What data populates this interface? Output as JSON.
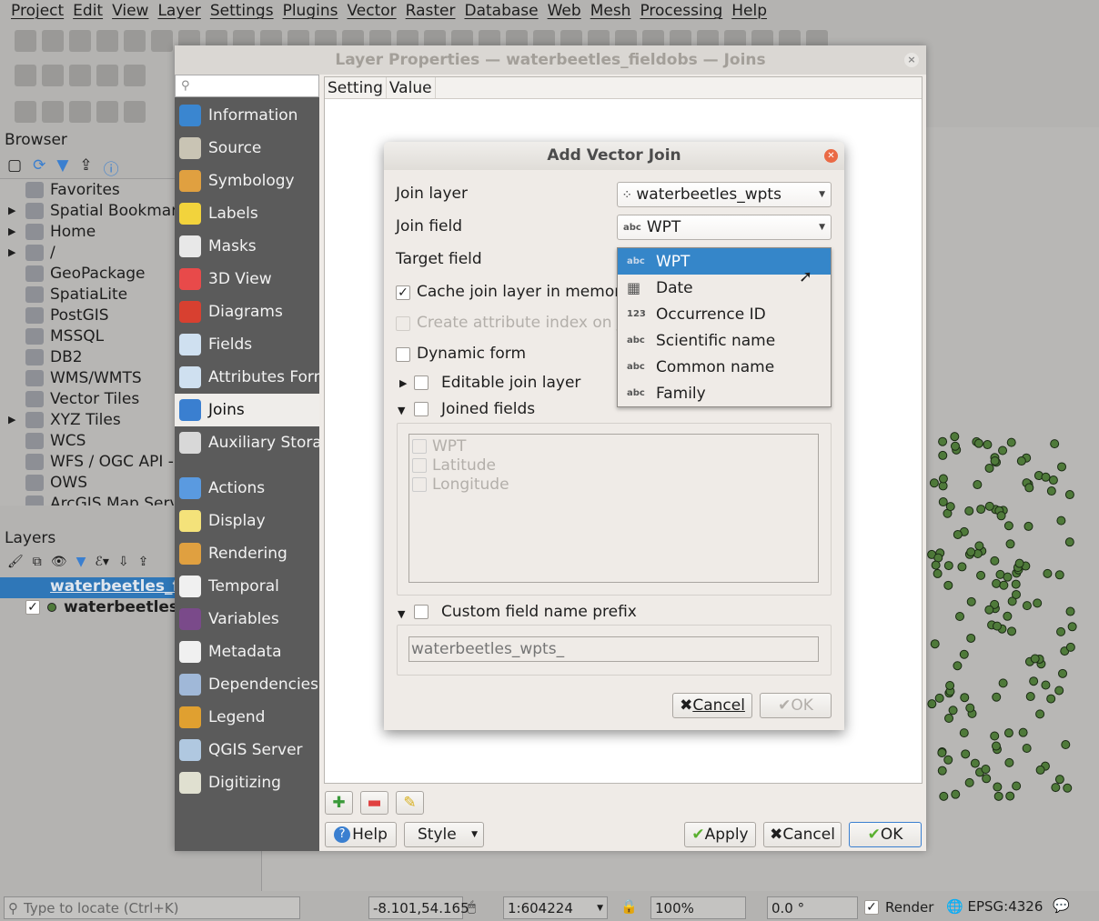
{
  "menubar": [
    "Project",
    "Edit",
    "View",
    "Layer",
    "Settings",
    "Plugins",
    "Vector",
    "Raster",
    "Database",
    "Web",
    "Mesh",
    "Processing",
    "Help"
  ],
  "browser": {
    "title": "Browser",
    "items": [
      {
        "label": "Favorites",
        "icon": "star-icon",
        "expand": false
      },
      {
        "label": "Spatial Bookmarks",
        "icon": "bookmark-icon",
        "expand": true
      },
      {
        "label": "Home",
        "icon": "home-folder-icon",
        "expand": true
      },
      {
        "label": "/",
        "icon": "folder-icon",
        "expand": true
      },
      {
        "label": "GeoPackage",
        "icon": "geopackage-icon",
        "expand": false
      },
      {
        "label": "SpatiaLite",
        "icon": "spatialite-icon",
        "expand": false
      },
      {
        "label": "PostGIS",
        "icon": "postgis-icon",
        "expand": false
      },
      {
        "label": "MSSQL",
        "icon": "mssql-icon",
        "expand": false
      },
      {
        "label": "DB2",
        "icon": "db2-icon",
        "expand": false
      },
      {
        "label": "WMS/WMTS",
        "icon": "globe-icon",
        "expand": false
      },
      {
        "label": "Vector Tiles",
        "icon": "grid-icon",
        "expand": false
      },
      {
        "label": "XYZ Tiles",
        "icon": "tiles-icon",
        "expand": true
      },
      {
        "label": "WCS",
        "icon": "globe-icon",
        "expand": false
      },
      {
        "label": "WFS / OGC API - Features",
        "icon": "globe-icon",
        "expand": false
      },
      {
        "label": "OWS",
        "icon": "globe-icon",
        "expand": false
      },
      {
        "label": "ArcGIS Map Service",
        "icon": "globe-icon",
        "expand": false
      }
    ]
  },
  "layers": {
    "title": "Layers",
    "items": [
      {
        "label": "waterbeetles_fieldobs",
        "selected": true
      },
      {
        "label": "waterbeetles_wpts",
        "checked": true
      }
    ]
  },
  "status": {
    "locate_placeholder": "Type to locate (Ctrl+K)",
    "coordinate": "-8.101,54.165",
    "scale": "1:604224",
    "magnifier": "100%",
    "rotation": "0.0 °",
    "render_label": "Render",
    "render_checked": true,
    "crs": "EPSG:4326"
  },
  "layer_properties": {
    "title": "Layer Properties — waterbeetles_fieldobs — Joins",
    "search_placeholder": "",
    "sections": [
      {
        "label": "Information",
        "color": "#3a86d0"
      },
      {
        "label": "Source",
        "color": "#c9c4b4"
      },
      {
        "label": "Symbology",
        "color": "#e0a040"
      },
      {
        "label": "Labels",
        "color": "#f2d33c"
      },
      {
        "label": "Masks",
        "color": "#e8e8e8"
      },
      {
        "label": "3D View",
        "color": "#e84a4a"
      },
      {
        "label": "Diagrams",
        "color": "#d84030"
      },
      {
        "label": "Fields",
        "color": "#cfe0f0"
      },
      {
        "label": "Attributes Form",
        "color": "#cfe0f0"
      },
      {
        "label": "Joins",
        "color": "#3a7fd0",
        "selected": true
      },
      {
        "label": "Auxiliary Storage",
        "color": "#d8d8d8"
      },
      {
        "label": "Actions",
        "color": "#5a9ae0"
      },
      {
        "label": "Display",
        "color": "#f4e27a"
      },
      {
        "label": "Rendering",
        "color": "#e0a040"
      },
      {
        "label": "Temporal",
        "color": "#f0f0f0"
      },
      {
        "label": "Variables",
        "color": "#7a4a8a"
      },
      {
        "label": "Metadata",
        "color": "#f0f0f0"
      },
      {
        "label": "Dependencies",
        "color": "#a0b8d8"
      },
      {
        "label": "Legend",
        "color": "#e0a030"
      },
      {
        "label": "QGIS Server",
        "color": "#b0c8e0"
      },
      {
        "label": "Digitizing",
        "color": "#e0e0d0"
      }
    ],
    "table_headers": [
      "Setting",
      "Value"
    ],
    "buttons": {
      "help": "Help",
      "style": "Style",
      "apply": "Apply",
      "cancel": "Cancel",
      "ok": "OK"
    }
  },
  "add_vector_join": {
    "title": "Add Vector Join",
    "join_layer_label": "Join layer",
    "join_layer_value": "waterbeetles_wpts",
    "join_field_label": "Join field",
    "join_field_value": "WPT",
    "join_field_type": "abc",
    "target_field_label": "Target field",
    "cache_label": "Cache join layer in memory",
    "cache_checked": true,
    "index_label": "Create attribute index on join field",
    "dynamic_label": "Dynamic form",
    "editable_label": "Editable join layer",
    "joined_fields_label": "Joined fields",
    "joined_fields": [
      "WPT",
      "Latitude",
      "Longitude"
    ],
    "prefix_label": "Custom field name prefix",
    "prefix_placeholder": "waterbeetles_wpts_",
    "cancel": "Cancel",
    "ok": "OK",
    "dropdown": [
      {
        "type": "abc",
        "label": "WPT",
        "selected": true
      },
      {
        "type": "date",
        "label": "Date"
      },
      {
        "type": "123",
        "label": "Occurrence ID"
      },
      {
        "type": "abc",
        "label": "Scientific name"
      },
      {
        "type": "abc",
        "label": "Common name"
      },
      {
        "type": "abc",
        "label": "Family"
      }
    ]
  },
  "colors": {
    "selection": "#3586c9",
    "point_fill": "#4f7a3a",
    "sidebar": "#5b5b5b"
  }
}
